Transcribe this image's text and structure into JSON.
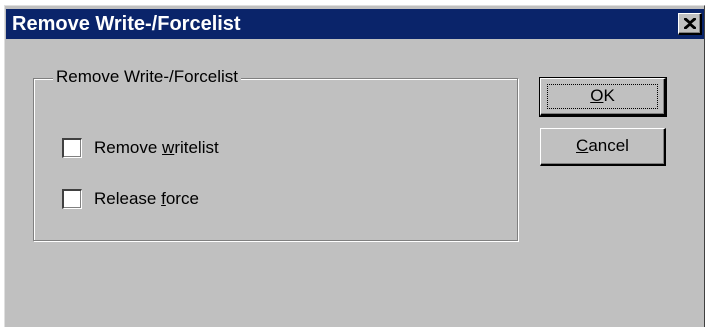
{
  "window": {
    "title": "Remove Write-/Forcelist"
  },
  "icons": {
    "close": "close-icon"
  },
  "groupbox": {
    "legend": "Remove Write-/Forcelist"
  },
  "options": [
    {
      "label_before": "Remove ",
      "label_access_key": "w",
      "label_after": "ritelist",
      "checked": false
    },
    {
      "label_before": "Release ",
      "label_access_key": "f",
      "label_after": "orce",
      "checked": false
    }
  ],
  "buttons": {
    "ok": {
      "access_key": "O",
      "rest": "K"
    },
    "cancel": {
      "access_key": "C",
      "rest": "ancel"
    }
  },
  "colors": {
    "titlebar": "#0a246a",
    "face": "#c0c0c0"
  }
}
